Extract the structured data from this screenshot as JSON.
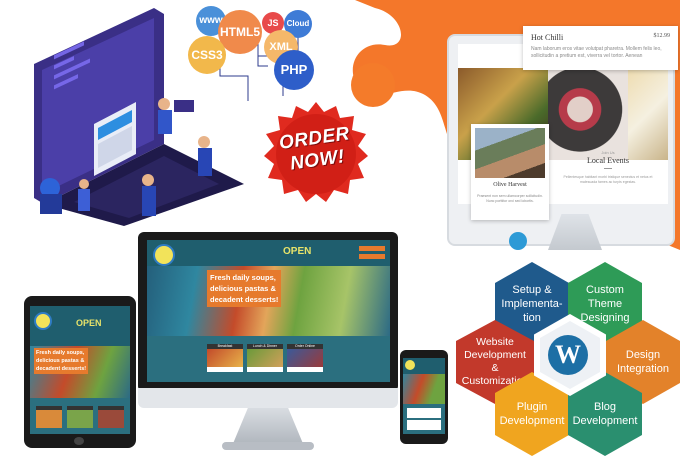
{
  "tech_bubbles": [
    "www",
    "HTML5",
    "JS",
    "Cloud",
    "CSS3",
    "XML",
    "PHP"
  ],
  "order_badge": {
    "line1": "ORDER",
    "line2": "NOW!"
  },
  "restaurant_theme": {
    "menu_title": "Hot Chilli",
    "menu_price": "$12.99",
    "menu_desc": "Nam laborum eros vitae volutpat pharetra. Mollem felis leo, sollicitudin a pretium est, viverra vel tortor. Aenean",
    "card_title": "Olive Harvest",
    "card_desc": "Praesent non sem ullamcorper sollicitudin. Nunc porttitor orci sed lobortis.",
    "events_small": "Join Us",
    "events_title": "Local Events",
    "events_desc": "Pellentesque habitant morbi tristique senectus et netus et malesuada fames ac turpis egestas."
  },
  "cafe_site": {
    "open_label": "OPEN",
    "promo_lines": [
      "Fresh daily soups,",
      "delicious pastas &",
      "decadent desserts!"
    ],
    "cards": [
      "Breakfast",
      "Lunch & Dinner",
      "Order Online"
    ]
  },
  "services": [
    {
      "label": "Setup & Implementa-tion",
      "color": "#1f5a8c"
    },
    {
      "label": "Custom Theme Designing",
      "color": "#2e9b57"
    },
    {
      "label": "Website Development & Customization",
      "color": "#c2392b"
    },
    {
      "label": "Design Integration",
      "color": "#e3822a"
    },
    {
      "label": "Plugin Development",
      "color": "#f0a51f"
    },
    {
      "label": "Blog Development",
      "color": "#2a8f6f"
    }
  ],
  "wordpress_logo": "W"
}
